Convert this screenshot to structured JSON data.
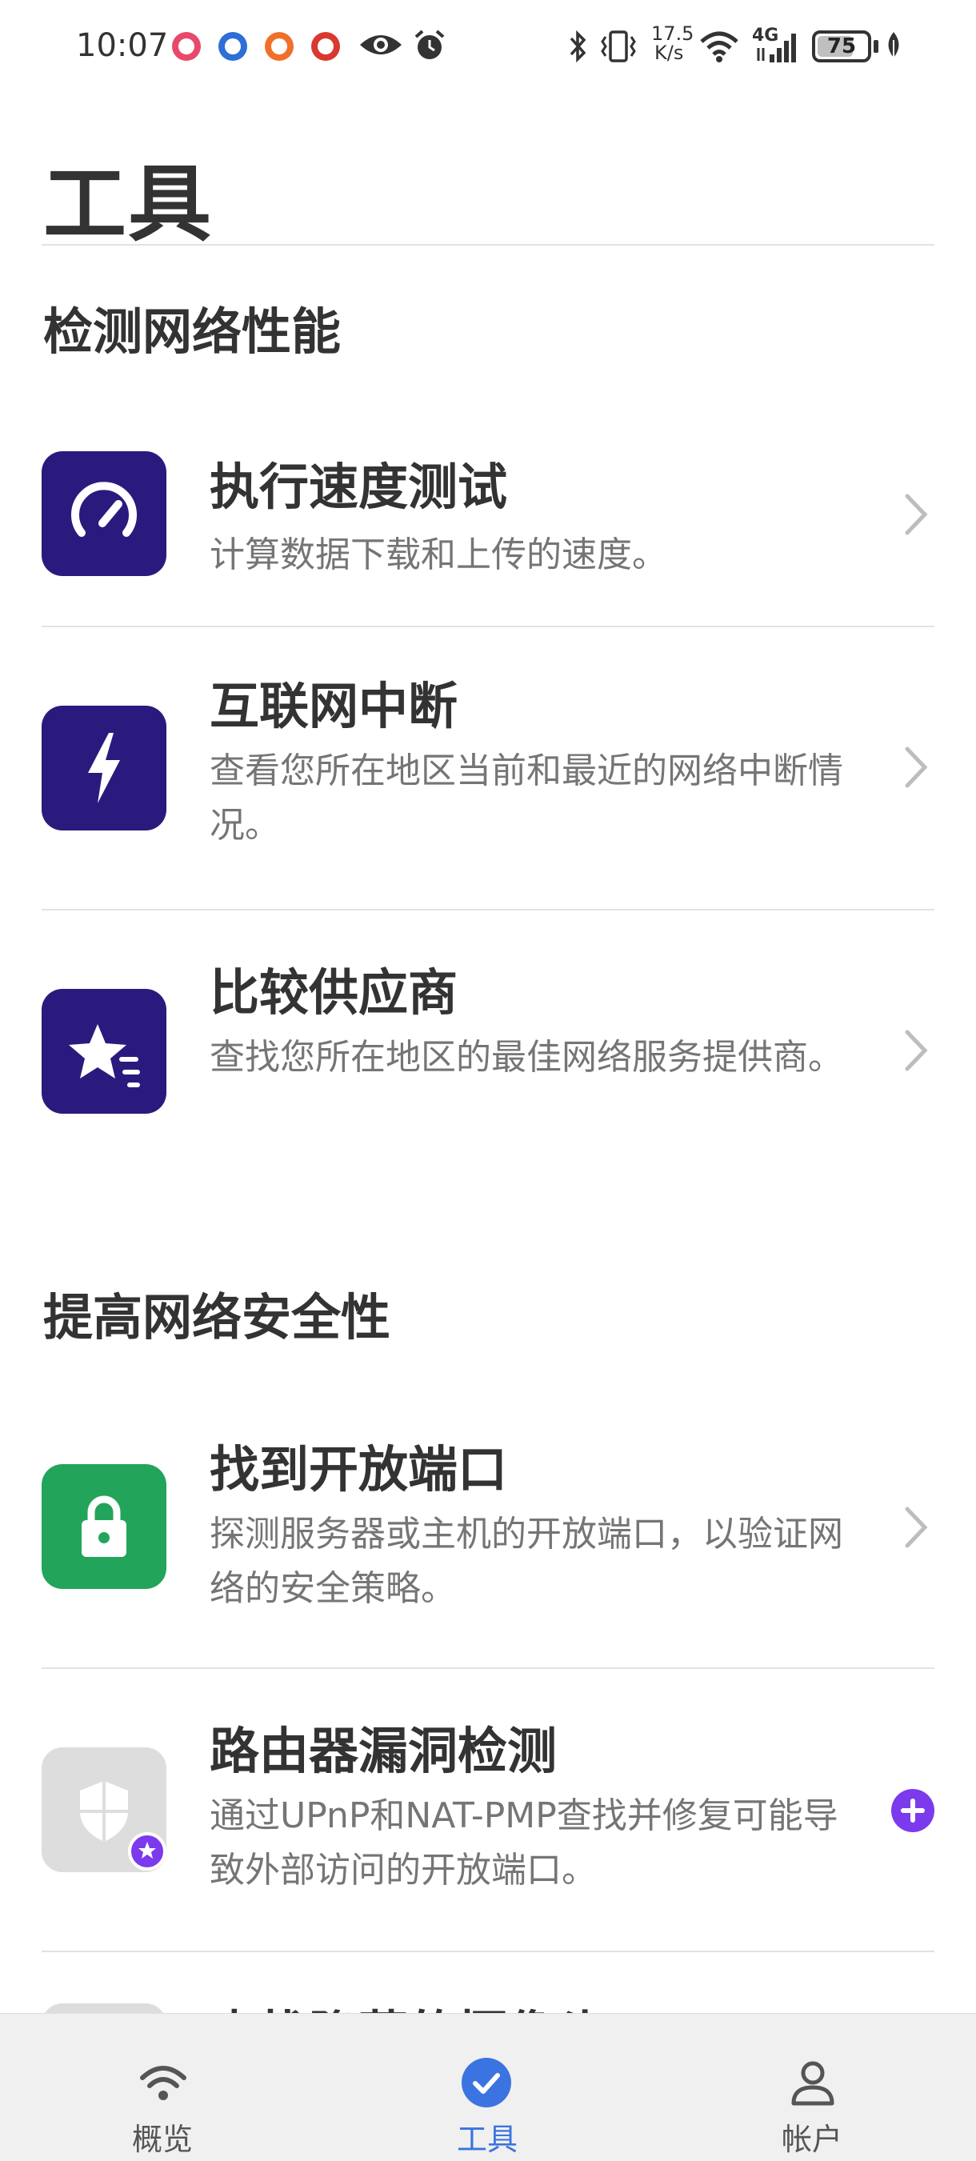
{
  "status_bar": {
    "time": "10:07",
    "net_speed_value": "17.5",
    "net_speed_unit": "K/s",
    "network_type": "4G",
    "battery_level": "75",
    "battery_fraction": 0.75
  },
  "header": {
    "title": "工具"
  },
  "sections": [
    {
      "title": "检测网络性能",
      "items": [
        {
          "title": "执行速度测试",
          "desc": "计算数据下载和上传的速度。",
          "icon": "speedometer-icon",
          "color": "#2b1a7e"
        },
        {
          "title": "互联网中断",
          "desc": "查看您所在地区当前和最近的网络中断情况。",
          "icon": "lightning-bolt-icon",
          "color": "#2b1a7e"
        },
        {
          "title": "比较供应商",
          "desc": "查找您所在地区的最佳网络服务提供商。",
          "icon": "star-icon",
          "color": "#2b1a7e"
        }
      ]
    },
    {
      "title": "提高网络安全性",
      "items": [
        {
          "title": "找到开放端口",
          "desc": "探测服务器或主机的开放端口，以验证网络的安全策略。",
          "icon": "lock-icon",
          "color": "#22a55b"
        },
        {
          "title": "路由器漏洞检测",
          "desc": "通过UPnP和NAT-PMP查找并修复可能导致外部访问的开放端口。",
          "icon": "shield-icon",
          "color": "#dddddd"
        },
        {
          "title": "查找隐藏的摄像头",
          "desc": "",
          "icon": "camera-icon",
          "color": "#dddddd"
        }
      ]
    }
  ],
  "bottom_nav": [
    {
      "label": "概览",
      "icon": "wifi-icon",
      "active": false
    },
    {
      "label": "工具",
      "icon": "check-circle-icon",
      "active": true
    },
    {
      "label": "帐户",
      "icon": "user-icon",
      "active": false
    }
  ],
  "colors": {
    "accent_blue": "#3b74e0",
    "premium_purple": "#7c3aed",
    "text_dark": "#333333",
    "text_muted": "#757575"
  }
}
